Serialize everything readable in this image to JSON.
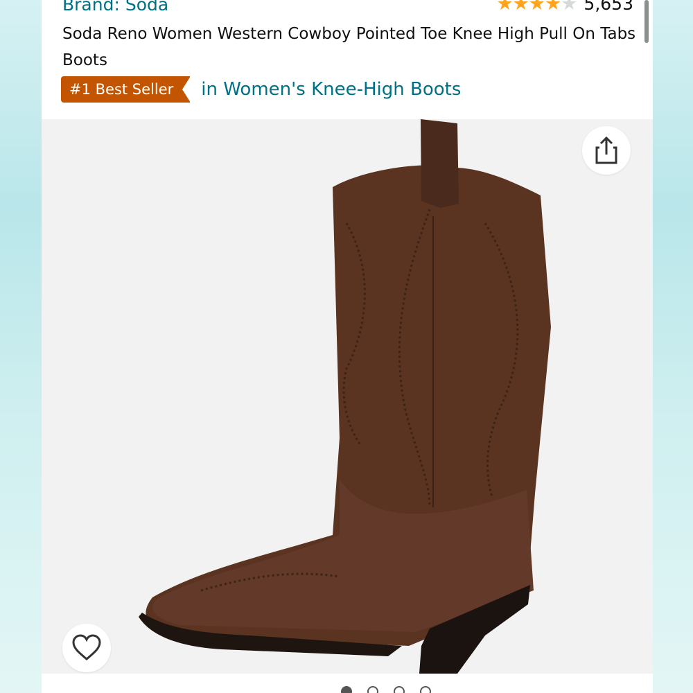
{
  "product": {
    "brand": "Brand: Soda",
    "rating_count": "5,653",
    "stars_filled": 4,
    "title": "Soda Reno Women Western Cowboy Pointed Toe Knee High Pull On Tabs Boots",
    "badge": "#1 Best Seller",
    "category": "in Women's Knee-High Boots"
  },
  "icons": {
    "share": "share-icon",
    "wishlist": "heart-icon",
    "star": "star-icon"
  },
  "carousel": {
    "count": 4,
    "active": 1
  },
  "colors": {
    "link": "#007185",
    "badge": "#c45500",
    "star": "#ffa41c",
    "boot": "#5a3321"
  }
}
